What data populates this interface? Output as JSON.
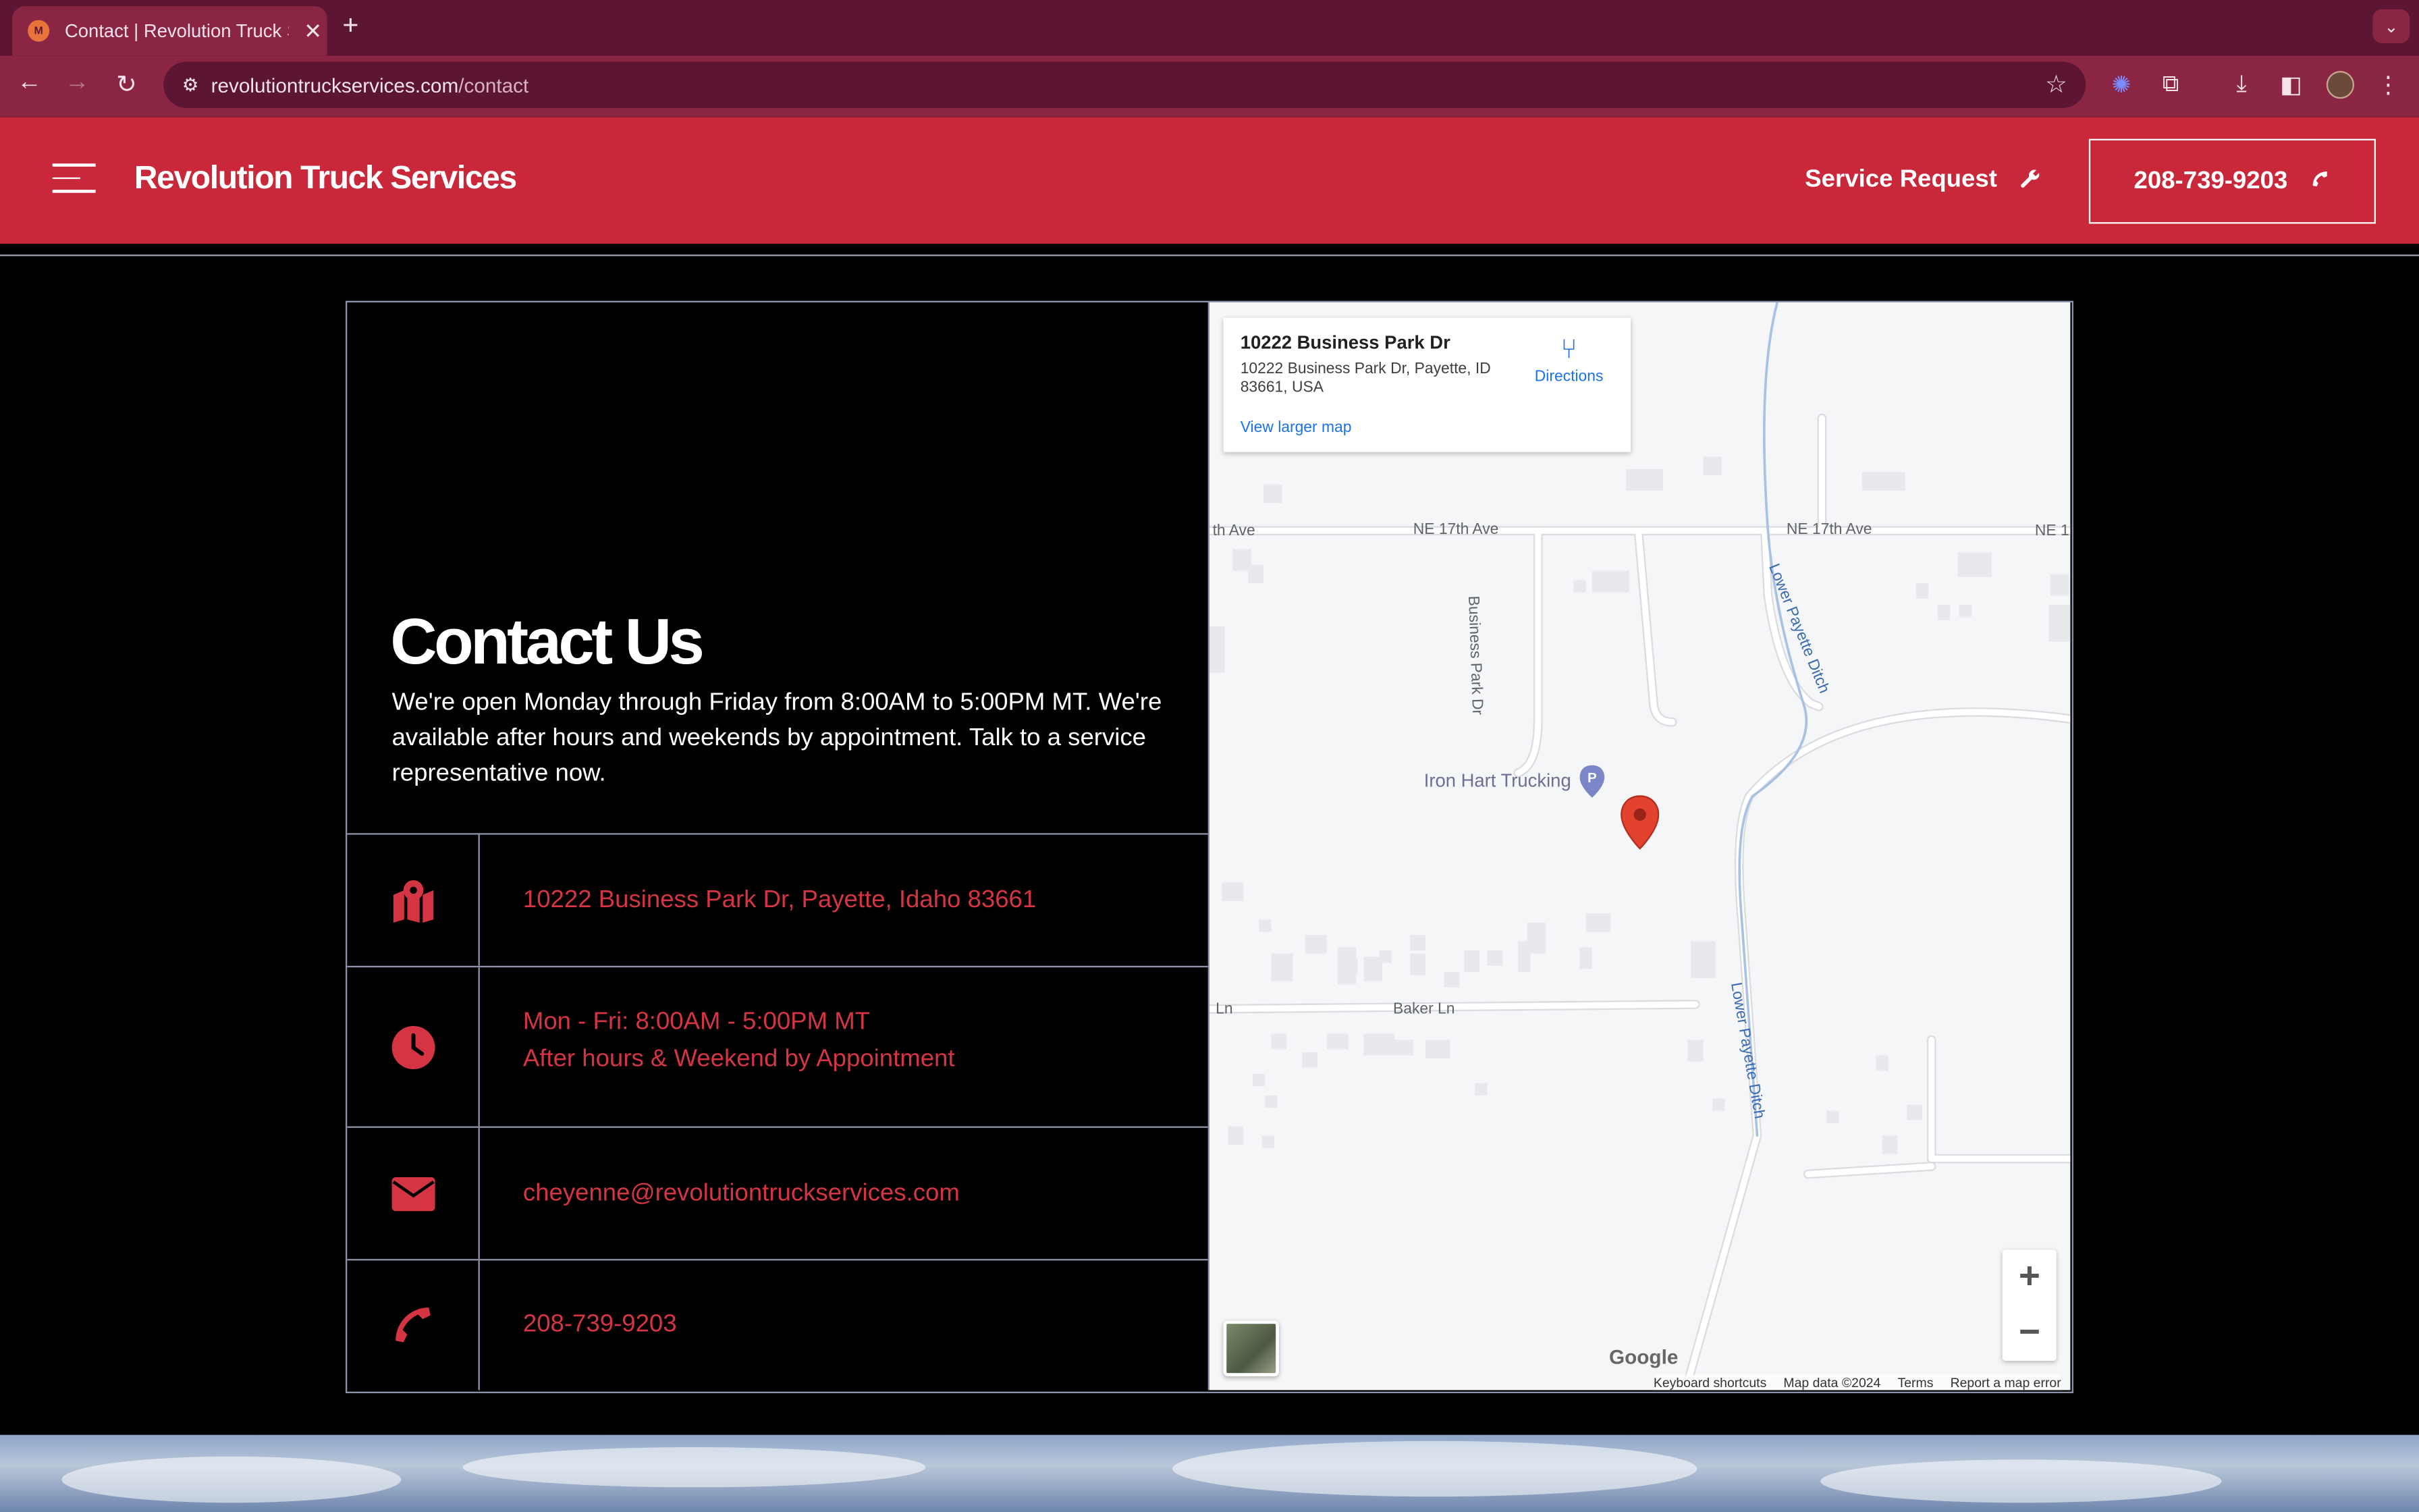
{
  "browser": {
    "tab_title": "Contact | Revolution Truck Se",
    "tab_favicon_text": "M",
    "url_host": "revolutiontruckservices.com",
    "url_path": "/contact",
    "new_tab": "+",
    "close": "✕"
  },
  "header": {
    "brand": "Revolution Truck Services",
    "service_request": "Service Request",
    "phone": "208-739-9203"
  },
  "contact": {
    "heading": "Contact Us",
    "blurb": "We're open Monday through Friday from 8:00AM to 5:00PM MT. We're available after hours and weekends by appointment. Talk to a service representative now.",
    "address": "10222 Business Park Dr, Payette, Idaho 83661",
    "hours_line1": "Mon - Fri: 8:00AM - 5:00PM MT",
    "hours_line2": "After hours & Weekend by Appointment",
    "email": "cheyenne@revolutiontruckservices.com",
    "phone": "208-739-9203"
  },
  "map": {
    "card_title": "10222 Business Park Dr",
    "card_address": "10222 Business Park Dr, Payette, ID 83661, USA",
    "card_link": "View larger map",
    "directions": "Directions",
    "labels": {
      "ne17_left": "th Ave",
      "ne17_mid": "NE 17th Ave",
      "ne17_right": "NE 17th Ave",
      "ne1_edge": "NE 1",
      "business_park": "Business Park Dr",
      "lower_payette_1": "Lower Payette Ditch",
      "lower_payette_2": "Lower Payette Ditch",
      "iron_hart": "Iron Hart Trucking",
      "baker_ln": "Baker Ln",
      "ln_edge": "Ln"
    },
    "google": "Google",
    "footer": {
      "shortcuts": "Keyboard shortcuts",
      "map_data": "Map data ©2024",
      "terms": "Terms",
      "report": "Report a map error"
    }
  }
}
